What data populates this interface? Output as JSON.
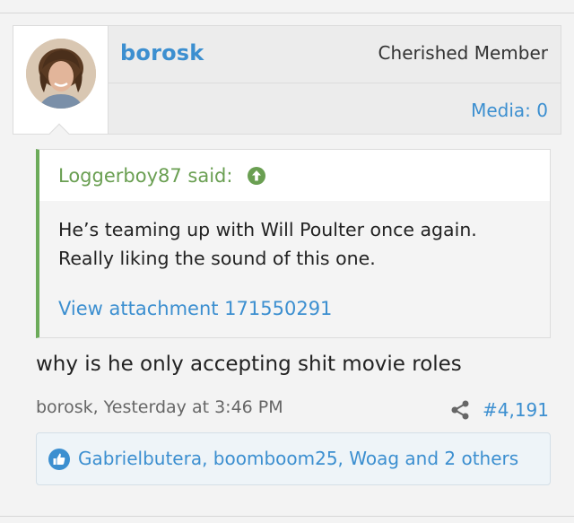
{
  "post": {
    "username": "borosk",
    "user_title": "Cherished Member",
    "media_count": "Media: 0",
    "quote": {
      "author": "Loggerboy87 said:",
      "line1": "He’s teaming up with Will Poulter once again.",
      "line2": "Really liking the sound of this one.",
      "attachment_link": "View attachment 171550291"
    },
    "body": "why is he only accepting shit movie roles",
    "meta": "borosk, Yesterday at 3:46 PM",
    "post_number": "#4,191",
    "likes": "Gabrielbutera, boomboom25, Woag and 2 others"
  },
  "icons": {
    "quote_arrow": "arrow-up-circle-icon",
    "share": "share-icon",
    "like": "thumbs-up-icon"
  },
  "colors": {
    "link": "#3c8fd0",
    "quote_accent": "#6cab5a",
    "quote_author": "#6a9f52"
  }
}
